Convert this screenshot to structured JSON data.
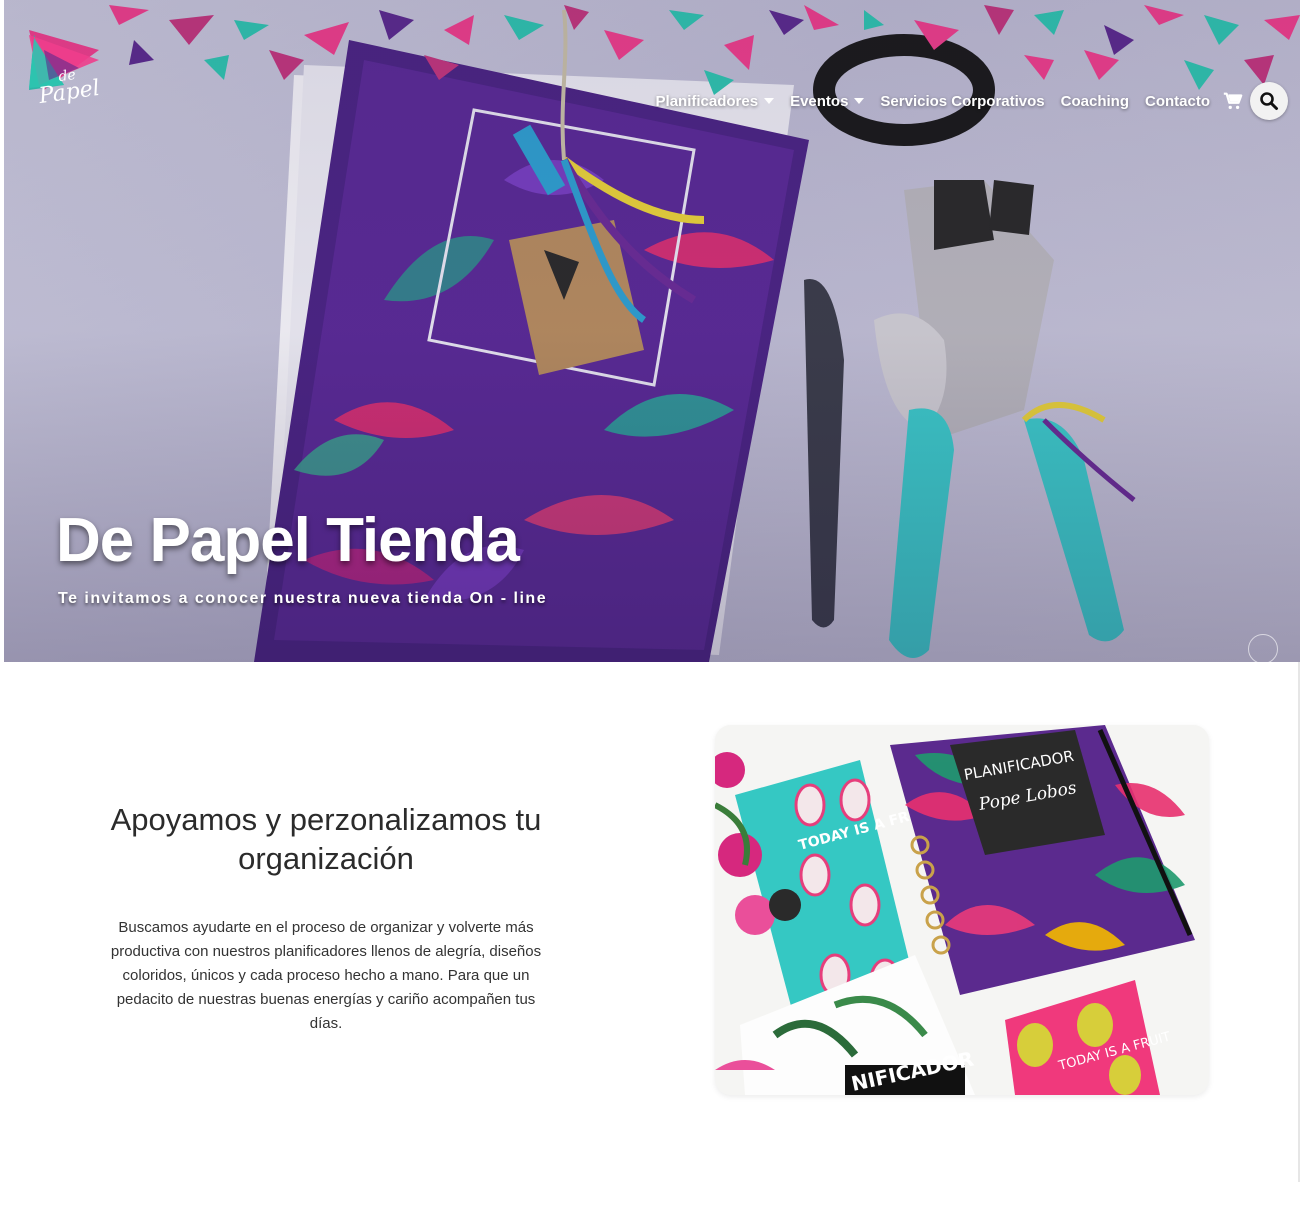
{
  "brand": {
    "logo_line1": "de",
    "logo_line2": "Papel",
    "colors": {
      "pink": "#ee3e8c",
      "teal": "#2ec4b0",
      "purple": "#5b2a8e",
      "turquoise": "#3cc9c6"
    }
  },
  "nav": {
    "items": [
      {
        "label": "Planificadores",
        "dropdown": true
      },
      {
        "label": "Eventos",
        "dropdown": true
      },
      {
        "label": "Servicios Corporativos",
        "dropdown": false
      },
      {
        "label": "Coaching",
        "dropdown": false
      },
      {
        "label": "Contacto",
        "dropdown": false
      }
    ],
    "cart_icon": "shopping-cart-icon",
    "search_icon": "search-icon"
  },
  "hero": {
    "title": "De Papel Tienda",
    "subtitle": "Te invitamos a conocer nuestra nueva tienda On - line"
  },
  "intro": {
    "heading": "Apoyamos y perzonalizamos tu organización",
    "body": "Buscamos ayudarte en el proceso de organizar y volverte más productiva con nuestros planificadores llenos de alegría, diseños coloridos, únicos y cada proceso hecho a mano. Para que un pedacito de nuestras buenas energías y cariño acompañen tus días."
  },
  "photo": {
    "planner_label_1": "PLANIFICADOR",
    "planner_label_2": "Pope Lobos",
    "notebook_text": "TODAY IS A FRUIT DAY",
    "notebook_text_2": "TODAY IS A FRUIT",
    "planner_bottom": "NIFICADOR"
  }
}
